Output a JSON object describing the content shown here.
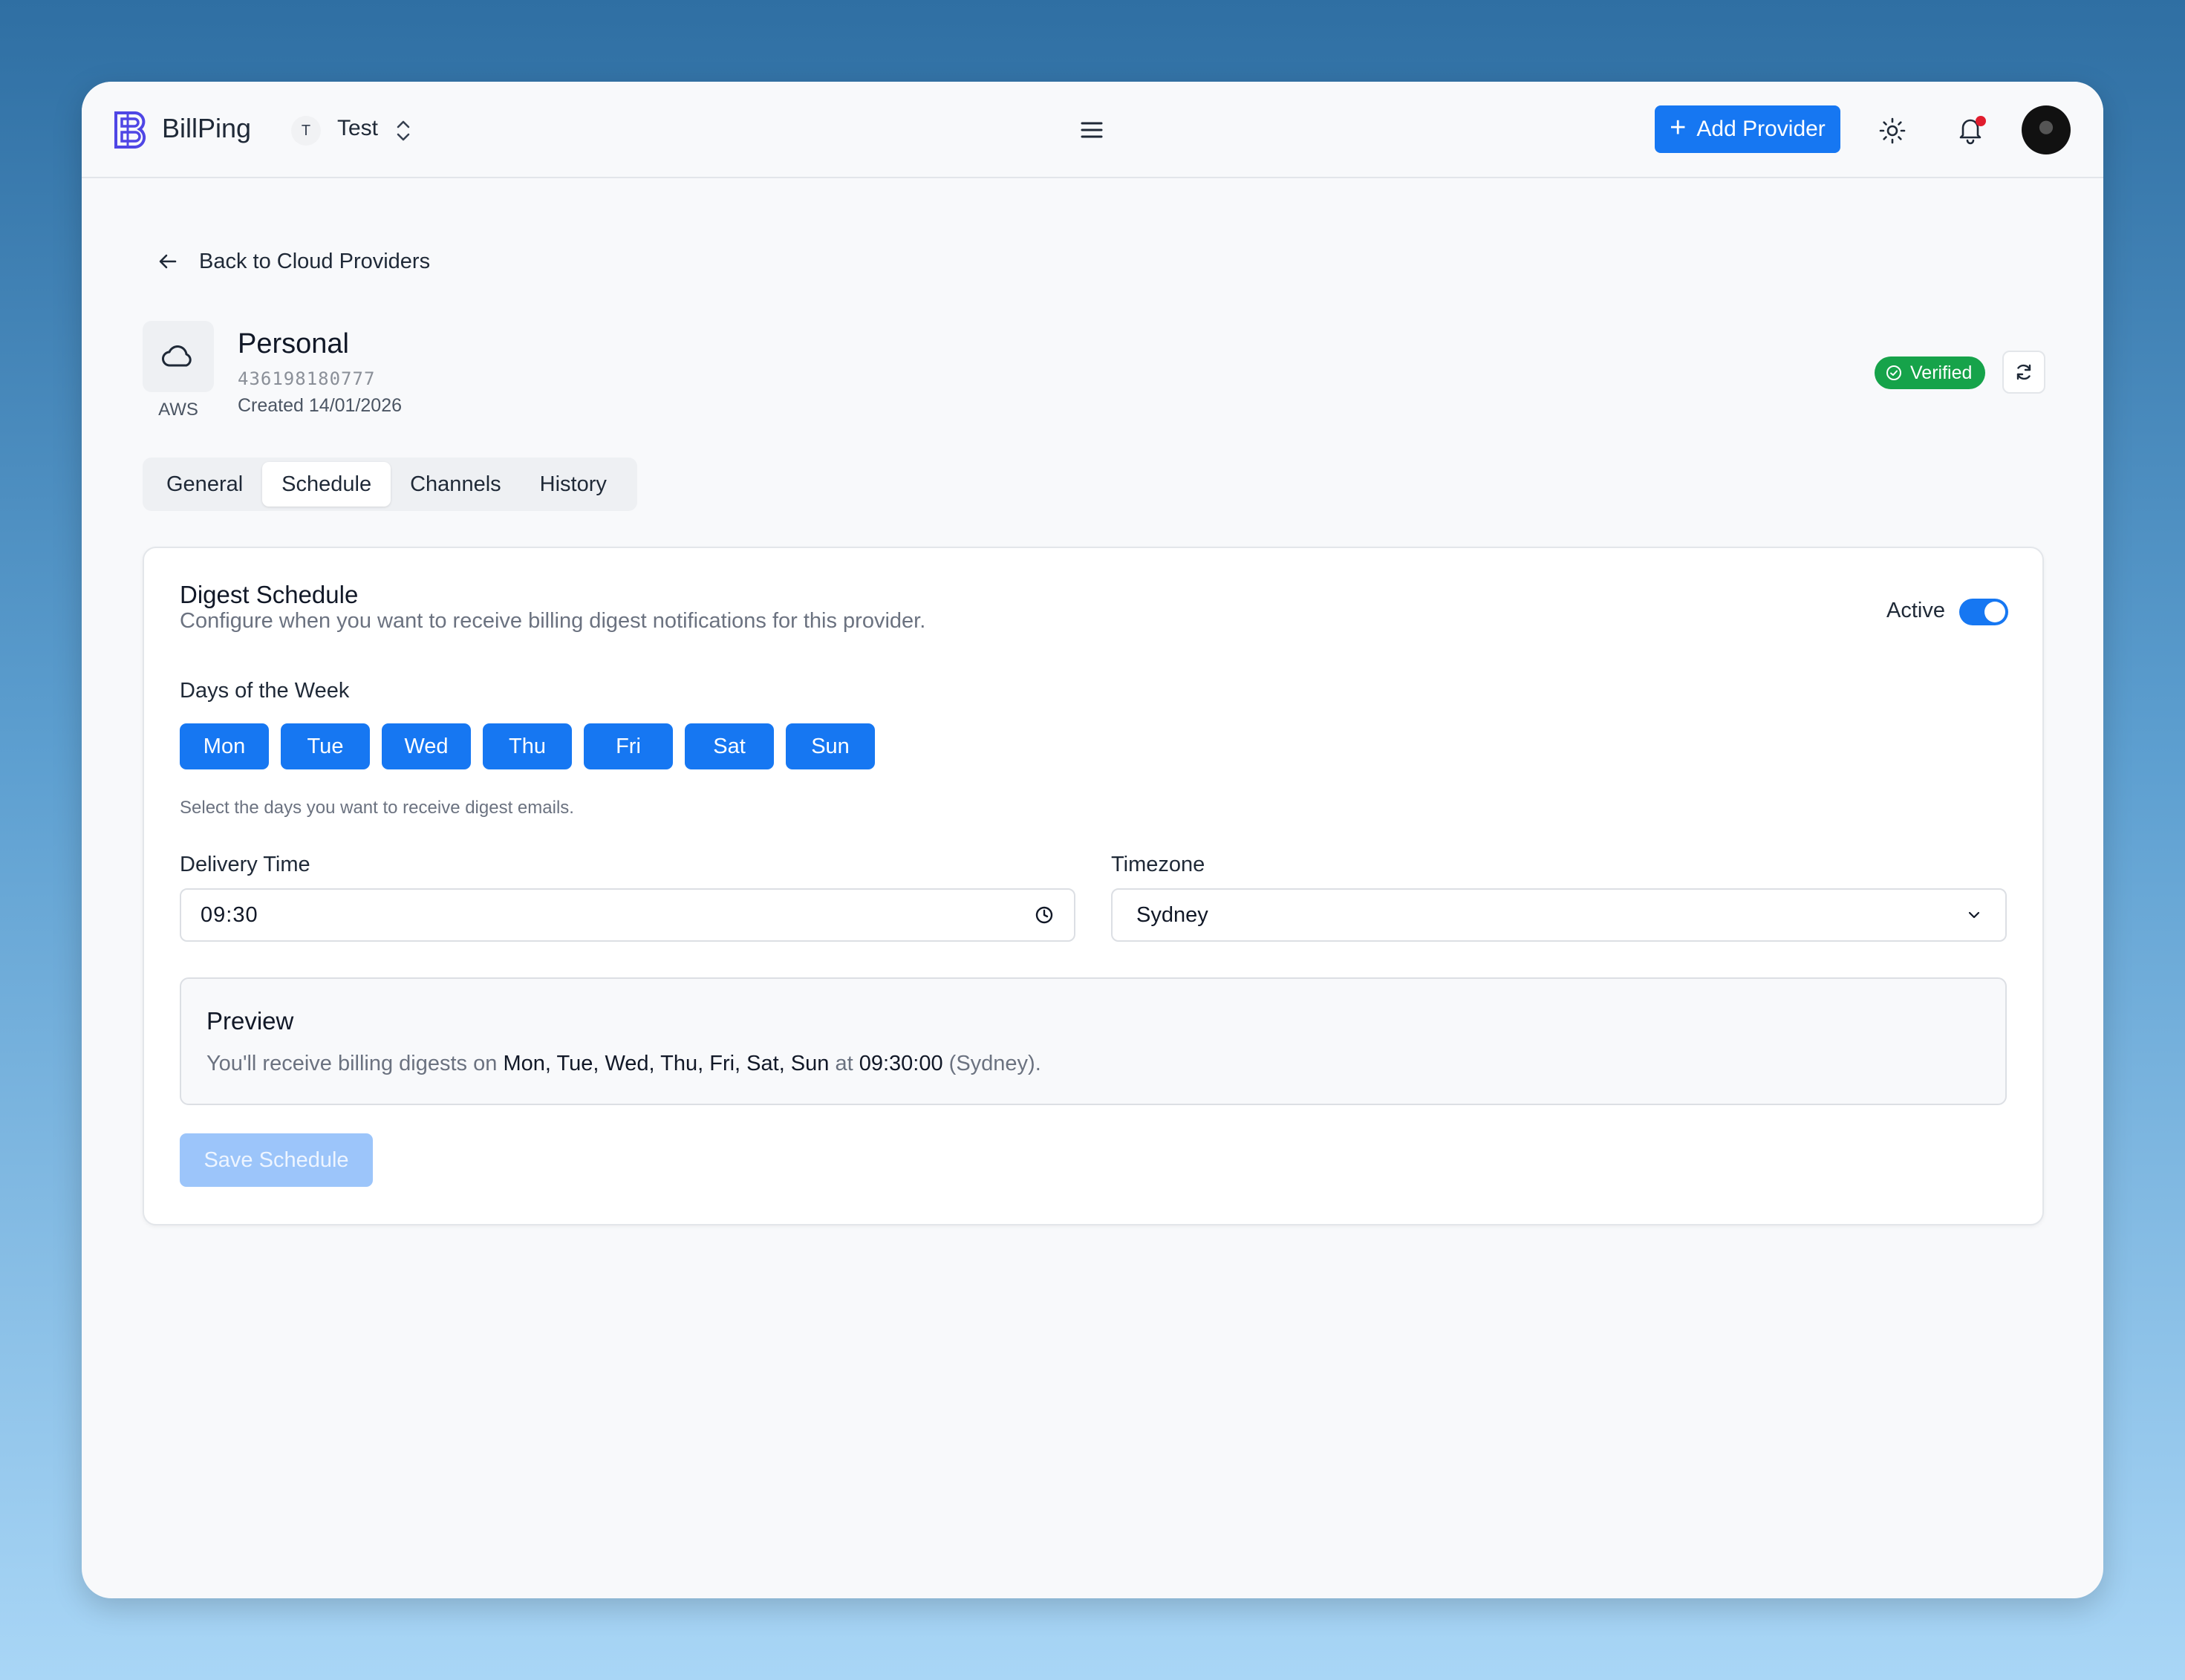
{
  "app": {
    "brand": "BillPing",
    "workspace_initial": "T",
    "workspace_name": "Test",
    "add_provider_label": "Add Provider"
  },
  "nav": {
    "back_label": "Back to Cloud Providers"
  },
  "provider": {
    "type": "AWS",
    "name": "Personal",
    "account_id": "436198180777",
    "created": "Created 14/01/2026",
    "status": "Verified"
  },
  "tabs": [
    {
      "label": "General",
      "active": false
    },
    {
      "label": "Schedule",
      "active": true
    },
    {
      "label": "Channels",
      "active": false
    },
    {
      "label": "History",
      "active": false
    }
  ],
  "schedule": {
    "title": "Digest Schedule",
    "description": "Configure when you want to receive billing digest notifications for this provider.",
    "active_label": "Active",
    "active": true,
    "days_label": "Days of the Week",
    "days": [
      "Mon",
      "Tue",
      "Wed",
      "Thu",
      "Fri",
      "Sat",
      "Sun"
    ],
    "days_hint": "Select the days you want to receive digest emails.",
    "delivery_time_label": "Delivery Time",
    "delivery_time": "09:30",
    "timezone_label": "Timezone",
    "timezone": "Sydney",
    "save_label": "Save Schedule"
  },
  "preview": {
    "title": "Preview",
    "prefix": "You'll receive billing digests on ",
    "days": "Mon, Tue, Wed, Thu, Fri, Sat, Sun",
    "at": " at ",
    "time": "09:30:00",
    "tz": " (Sydney)."
  },
  "colors": {
    "accent": "#1677f2",
    "verified": "#16a34a",
    "notification_dot": "#e11d2e"
  }
}
